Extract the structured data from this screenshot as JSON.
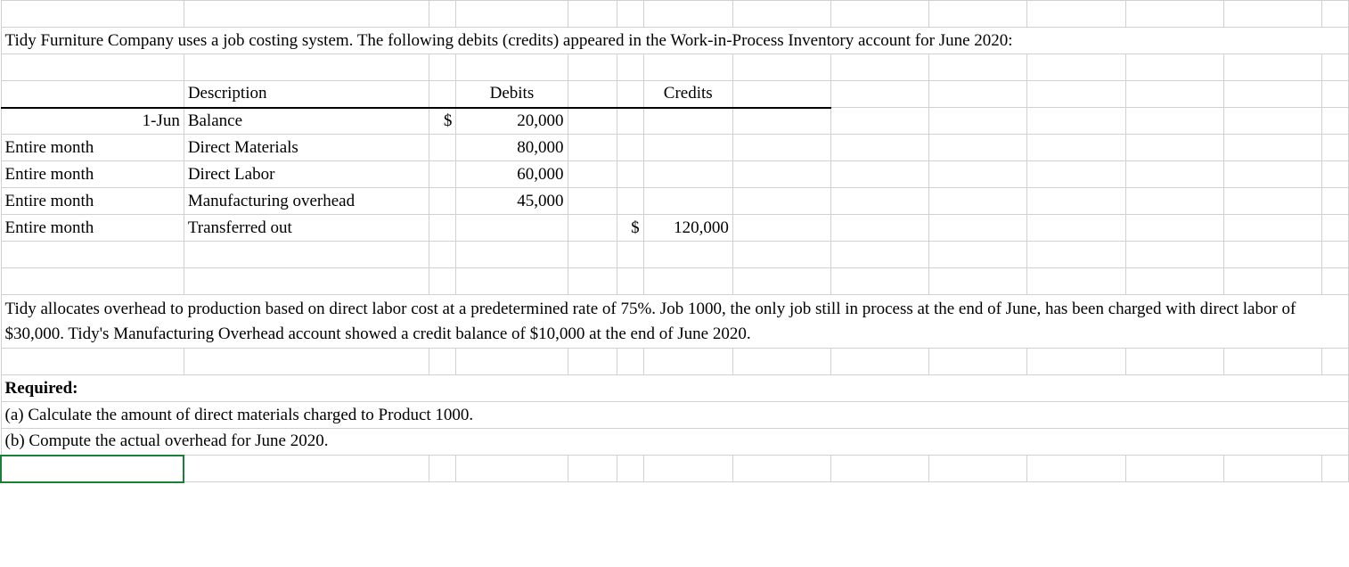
{
  "intro": "Tidy Furniture Company uses a job costing system. The following debits (credits) appeared in the Work-in-Process Inventory account for June 2020:",
  "headers": {
    "description": "Description",
    "debits": "Debits",
    "credits": "Credits"
  },
  "rows": [
    {
      "date": "1-Jun",
      "desc": "Balance",
      "debit_sym": "$",
      "debit": "20,000",
      "credit_sym": "",
      "credit": ""
    },
    {
      "date": "Entire month",
      "desc": "Direct Materials",
      "debit_sym": "",
      "debit": "80,000",
      "credit_sym": "",
      "credit": ""
    },
    {
      "date": "Entire month",
      "desc": "Direct Labor",
      "debit_sym": "",
      "debit": "60,000",
      "credit_sym": "",
      "credit": ""
    },
    {
      "date": "Entire month",
      "desc": "Manufacturing overhead",
      "debit_sym": "",
      "debit": "45,000",
      "credit_sym": "",
      "credit": ""
    },
    {
      "date": "Entire month",
      "desc": " Transferred out",
      "debit_sym": "",
      "debit": "",
      "credit_sym": "$",
      "credit": "120,000"
    }
  ],
  "para2": "Tidy allocates overhead to production based on direct labor cost at a predetermined rate of 75%. Job 1000, the only job still in process at the end of June, has been charged with direct labor of $30,000. Tidy's Manufacturing Overhead account showed a credit balance of $10,000 at the end of June 2020.",
  "required_label": "Required:",
  "req_a": "(a) Calculate the amount of direct materials charged to Product 1000.",
  "req_b": "(b) Compute the actual overhead for June 2020."
}
